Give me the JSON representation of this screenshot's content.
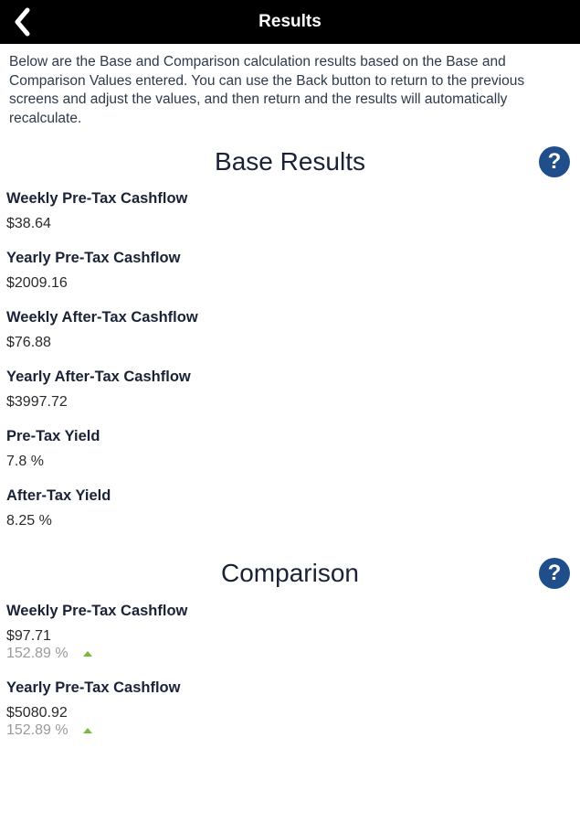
{
  "header": {
    "title": "Results",
    "back_icon": "chevron-left-icon"
  },
  "intro": "Below are the Base and Comparison calculation results based on the Base and Comparison Values entered. You can use the Back button to return to the previous screens and adjust the values, and then return and the results will automatically recalculate.",
  "base": {
    "title": "Base Results",
    "help_label": "?",
    "items": [
      {
        "label": "Weekly Pre-Tax Cashflow",
        "value": "$38.64"
      },
      {
        "label": "Yearly Pre-Tax Cashflow",
        "value": "$2009.16"
      },
      {
        "label": "Weekly After-Tax Cashflow",
        "value": "$76.88"
      },
      {
        "label": "Yearly After-Tax Cashflow",
        "value": "$3997.72"
      },
      {
        "label": "Pre-Tax Yield",
        "value": "7.8 %"
      },
      {
        "label": "After-Tax Yield",
        "value": "8.25 %"
      }
    ]
  },
  "comparison": {
    "title": "Comparison",
    "help_label": "?",
    "items": [
      {
        "label": "Weekly Pre-Tax Cashflow",
        "value": "$97.71",
        "change": "152.89 %",
        "trend": "up"
      },
      {
        "label": "Yearly Pre-Tax Cashflow",
        "value": "$5080.92",
        "change": "152.89 %",
        "trend": "up"
      }
    ]
  },
  "colors": {
    "header_bg": "#000000",
    "help_button": "#1f4e8a",
    "trend_up": "#7cb83a"
  }
}
